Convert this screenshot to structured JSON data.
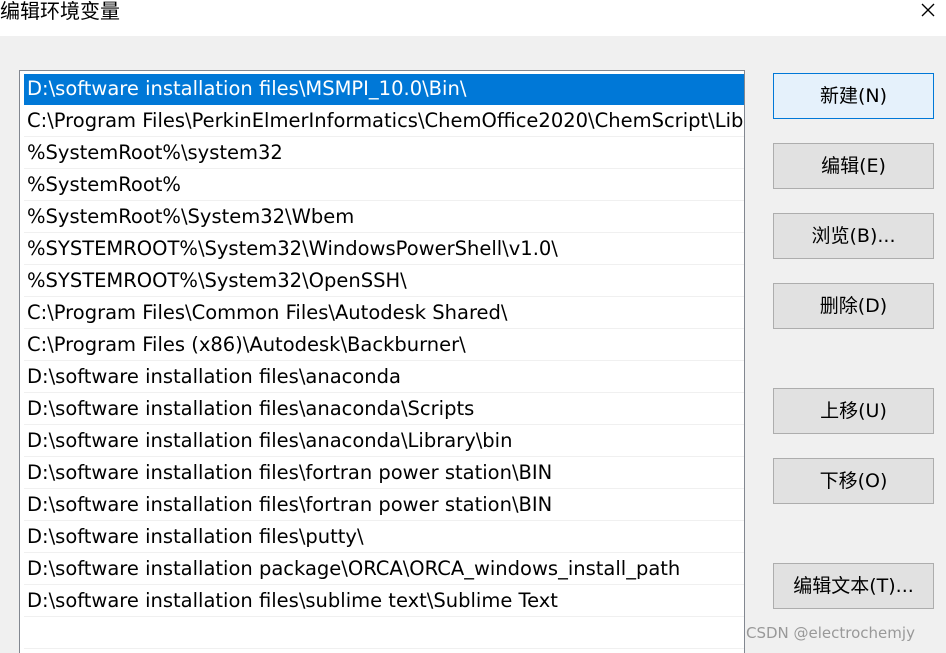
{
  "window": {
    "title": "编辑环境变量"
  },
  "path_list": {
    "items": [
      "D:\\software installation files\\MSMPI_10.0\\Bin\\",
      "C:\\Program Files\\PerkinElmerInformatics\\ChemOffice2020\\ChemScript\\Lib",
      "%SystemRoot%\\system32",
      "%SystemRoot%",
      "%SystemRoot%\\System32\\Wbem",
      "%SYSTEMROOT%\\System32\\WindowsPowerShell\\v1.0\\",
      "%SYSTEMROOT%\\System32\\OpenSSH\\",
      "C:\\Program Files\\Common Files\\Autodesk Shared\\",
      "C:\\Program Files (x86)\\Autodesk\\Backburner\\",
      "D:\\software installation files\\anaconda",
      "D:\\software installation files\\anaconda\\Scripts",
      "D:\\software installation files\\anaconda\\Library\\bin",
      "D:\\software installation files\\fortran power station\\BIN",
      "D:\\software installation files\\fortran power station\\BIN",
      "D:\\software installation files\\putty\\",
      "D:\\software installation package\\ORCA\\ORCA_windows_install_path",
      "D:\\software installation files\\sublime text\\Sublime Text"
    ]
  },
  "buttons": {
    "new": "新建(N)",
    "edit": "编辑(E)",
    "browse": "浏览(B)...",
    "delete": "删除(D)",
    "move_up": "上移(U)",
    "move_down": "下移(O)",
    "edit_text": "编辑文本(T)..."
  },
  "watermark": "CSDN @electrochemjy",
  "colors": {
    "selection": "#0078d7",
    "dialog_bg": "#f0f0f0",
    "button_bg": "#e1e1e1"
  }
}
